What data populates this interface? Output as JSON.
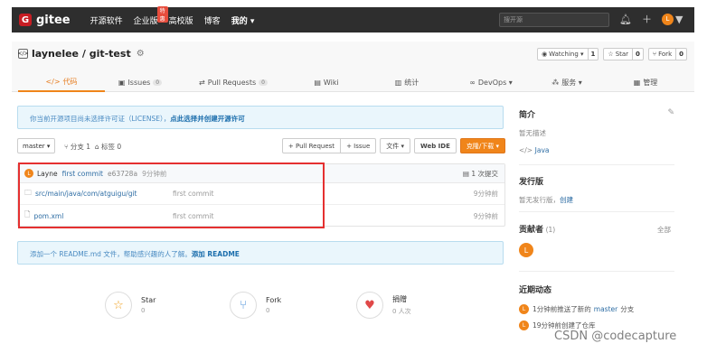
{
  "topnav": {
    "logo_mark": "G",
    "logo_text": "gitee",
    "links": [
      {
        "label": "开源软件"
      },
      {
        "label": "企业版",
        "badge": "特惠"
      },
      {
        "label": "高校版"
      },
      {
        "label": "博客"
      },
      {
        "label": "我的 ▾"
      }
    ],
    "search_placeholder": "搜开源",
    "avatar": "L"
  },
  "repo": {
    "owner": "laynelee",
    "separator": " / ",
    "name": "git-test",
    "watching_label": "Watching ▾",
    "watching_count": "1",
    "star_label": "Star",
    "star_count": "0",
    "fork_label": "Fork",
    "fork_count": "0"
  },
  "tabs": [
    {
      "label": "代码",
      "active": true
    },
    {
      "label": "Issues",
      "count": "0"
    },
    {
      "label": "Pull Requests",
      "count": "0"
    },
    {
      "label": "Wiki"
    },
    {
      "label": "统计"
    },
    {
      "label": "DevOps ▾"
    },
    {
      "label": "服务 ▾"
    },
    {
      "label": "管理"
    }
  ],
  "license_notice": {
    "text": "你当前开源项目尚未选择许可证（LICENSE），",
    "link": "点此选择并创建开源许可"
  },
  "toolbar": {
    "branch": "master ▾",
    "branch_count": "分支 1",
    "tag_count": "标签 0",
    "pull_request": "+ Pull Request",
    "issue": "+ Issue",
    "file": "文件 ▾",
    "webide": "Web IDE",
    "clone": "克隆/下载 ▾"
  },
  "latest_commit": {
    "avatar": "L",
    "author": "Layne",
    "message": "first commit",
    "hash": "e63728a",
    "time": "9分钟前",
    "count": "1 次提交"
  },
  "files": [
    {
      "name": "src/main/java/com/atguigu/git",
      "icon": "folder-icon",
      "commit": "first commit",
      "time": "9分钟前"
    },
    {
      "name": "pom.xml",
      "icon": "file-icon",
      "commit": "first commit",
      "time": "9分钟前"
    }
  ],
  "readme_notice": {
    "text": "添加一个 README.md 文件，帮助感兴趣的人了解。",
    "link": "添加 README"
  },
  "stats": [
    {
      "label": "Star",
      "value": "0",
      "icon": "star-icon"
    },
    {
      "label": "Fork",
      "value": "0",
      "icon": "fork-icon"
    },
    {
      "label": "捐赠",
      "value": "0 人次",
      "icon": "donate-icon"
    }
  ],
  "sidebar": {
    "intro_title": "简介",
    "intro_text": "暂无描述",
    "language": "Java",
    "release_title": "发行版",
    "release_text": "暂无发行版，",
    "release_link": "创建",
    "contrib_title": "贡献者",
    "contrib_count": "(1)",
    "contrib_all": "全部",
    "contrib_avatar": "L",
    "activity_title": "近期动态",
    "activity_1_prefix": "1分钟前推送了新的",
    "activity_1_branch": "master",
    "activity_1_suffix": "分支",
    "activity_2": "19分钟前创建了仓库"
  },
  "watermark": "CSDN @codecapture",
  "colors": {
    "nav_bg": "#2e2e2e",
    "accent": "#f0851a",
    "link": "#2e6da4",
    "highlight": "#e53030"
  }
}
